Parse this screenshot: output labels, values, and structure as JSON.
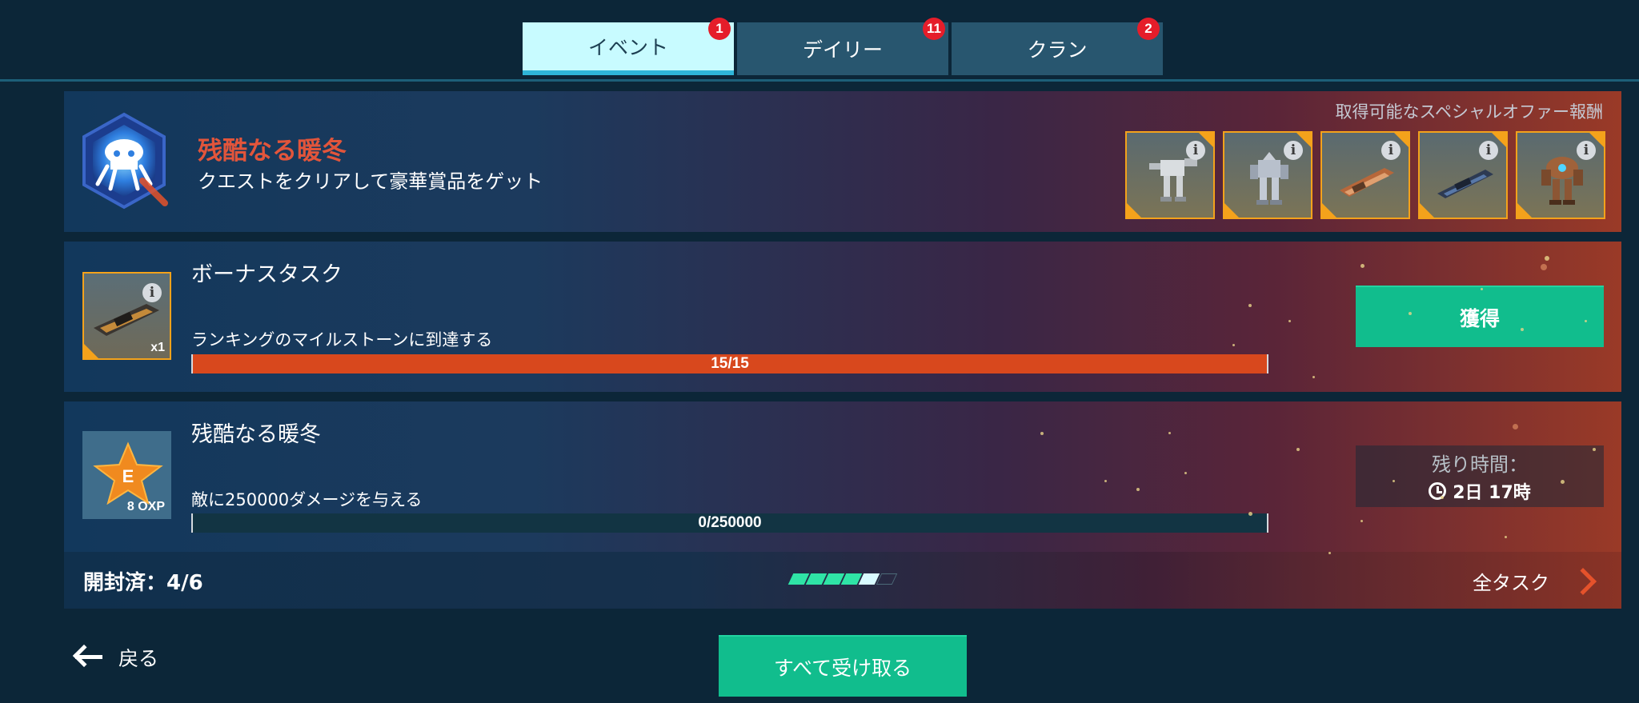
{
  "tabs": [
    {
      "label": "イベント",
      "badge": "1",
      "active": true
    },
    {
      "label": "デイリー",
      "badge": "11",
      "active": false
    },
    {
      "label": "クラン",
      "badge": "2",
      "active": false
    }
  ],
  "event": {
    "title": "残酷なる暖冬",
    "subtitle": "クエストをクリアして豪華賞品をゲット",
    "rewards_label": "取得可能なスペシャルオファー報酬",
    "rewards": [
      {
        "icon": "robot-reward-icon"
      },
      {
        "icon": "robot-reward-icon"
      },
      {
        "icon": "weapon-reward-icon"
      },
      {
        "icon": "weapon-reward-icon"
      },
      {
        "icon": "robot-reward-icon"
      }
    ]
  },
  "tasks": [
    {
      "title": "ボーナスタスク",
      "description": "ランキングのマイルストーンに到達する",
      "progress_text": "15/15",
      "progress": 1.0,
      "reward_qty": "x1",
      "action_label": "獲得"
    },
    {
      "title": "残酷なる暖冬",
      "description": "敵に250000ダメージを与える",
      "progress_text": "0/250000",
      "progress": 0.0,
      "reward_letter": "E",
      "reward_label": "8 OXP",
      "time_label": "残り時間：",
      "time_value": "2日 17時"
    }
  ],
  "footer": {
    "opened_label": "開封済：4/6",
    "opened": 4,
    "total": 6,
    "all_tasks_label": "全タスク"
  },
  "bottom": {
    "back_label": "戻る",
    "claim_all_label": "すべて受け取る"
  },
  "colors": {
    "claim_green": "#11bd8d",
    "progress_orange": "#d8481d",
    "badge_red": "#e51d2a",
    "event_title": "#e2553b",
    "reward_border": "#f4a21b"
  }
}
